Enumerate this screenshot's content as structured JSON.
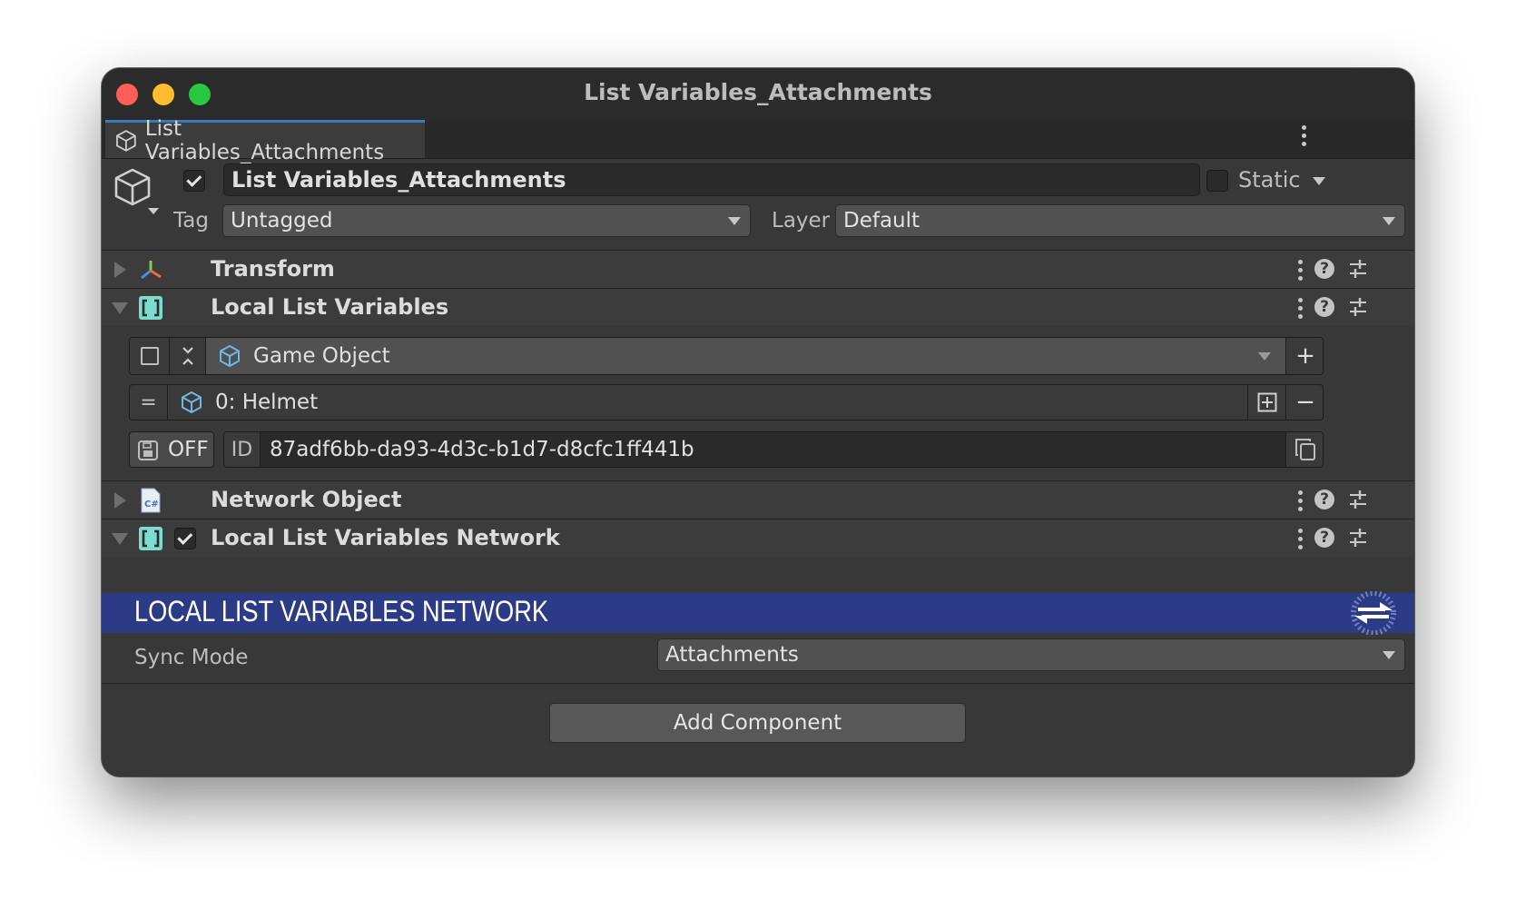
{
  "window": {
    "title": "List Variables_Attachments"
  },
  "tab": {
    "label": "List Variables_Attachments"
  },
  "game_object": {
    "name": "List Variables_Attachments",
    "active": true,
    "static_label": "Static",
    "static": false,
    "tag_label": "Tag",
    "tag_value": "Untagged",
    "layer_label": "Layer",
    "layer_value": "Default"
  },
  "components": {
    "transform": {
      "title": "Transform",
      "icon": "transform-axes-icon"
    },
    "local_list_variables": {
      "title": "Local List Variables",
      "icon": "list-brackets-icon",
      "type_value": "Game Object",
      "item_label": "0: Helmet",
      "save_label": "OFF",
      "id_label": "ID",
      "id_value": "87adf6bb-da93-4d3c-b1d7-d8cfc1ff441b"
    },
    "network_object": {
      "title": "Network Object",
      "icon": "csharp-script-icon"
    },
    "local_list_variables_network": {
      "title": "Local List Variables Network",
      "enabled": true,
      "banner": "LOCAL LIST VARIABLES NETWORK",
      "sync_mode_label": "Sync Mode",
      "sync_mode_value": "Attachments"
    }
  },
  "add_component_label": "Add Component",
  "colors": {
    "banner": "#2b3b85",
    "accent_cyan": "#7ddcd0",
    "tab_accent": "#3a79bb"
  }
}
